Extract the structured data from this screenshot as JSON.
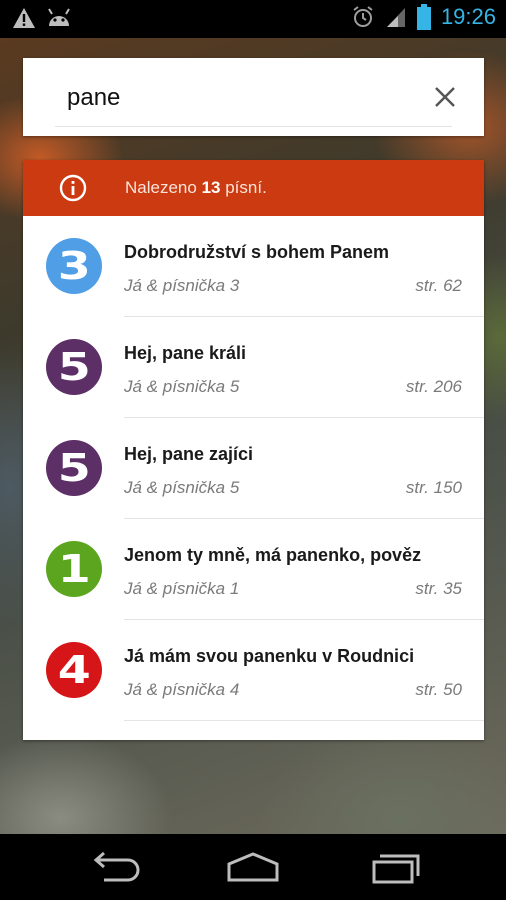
{
  "status_bar": {
    "time": "19:26",
    "icons": [
      "warning-icon",
      "android-icon",
      "alarm-icon",
      "signal-icon",
      "battery-icon"
    ],
    "time_color": "#35b5e5"
  },
  "search": {
    "value": "pane",
    "clear_icon": "close-icon"
  },
  "results_banner": {
    "prefix": "Nalezeno ",
    "count": "13",
    "suffix": " písní.",
    "color": "#cc3a11",
    "icon": "info-icon"
  },
  "results": [
    {
      "badge": "3",
      "badge_color": "#4f9ee6",
      "title": "Dobrodružství s bohem Panem",
      "book": "Já & písnička 3",
      "page": "str. 62"
    },
    {
      "badge": "5",
      "badge_color": "#5c2f66",
      "title": "Hej, pane králi",
      "book": "Já & písnička 5",
      "page": "str. 206"
    },
    {
      "badge": "5",
      "badge_color": "#5c2f66",
      "title": "Hej, pane zajíci",
      "book": "Já & písnička 5",
      "page": "str. 150"
    },
    {
      "badge": "1",
      "badge_color": "#5ba61e",
      "title": "Jenom ty mně, má panenko, pověz",
      "book": "Já & písnička 1",
      "page": "str. 35"
    },
    {
      "badge": "4",
      "badge_color": "#d61518",
      "title": "Já mám svou panenku v Roudnici",
      "book": "Já & písnička 4",
      "page": "str. 50"
    }
  ],
  "nav_bar": {
    "buttons": [
      "back-icon",
      "home-icon",
      "recents-icon"
    ]
  }
}
